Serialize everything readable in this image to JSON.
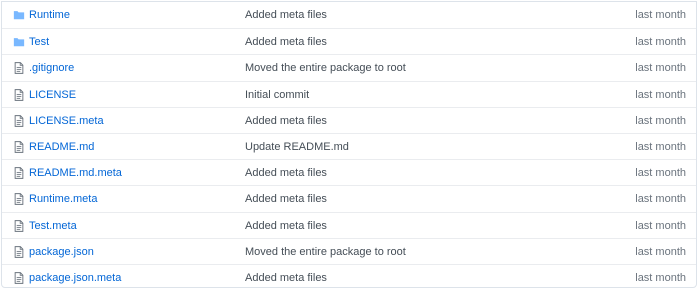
{
  "files": [
    {
      "name": "Runtime",
      "type": "dir",
      "icon": "folder-icon",
      "message": "Added meta files",
      "age": "last month"
    },
    {
      "name": "Test",
      "type": "dir",
      "icon": "folder-icon",
      "message": "Added meta files",
      "age": "last month"
    },
    {
      "name": ".gitignore",
      "type": "file",
      "icon": "file-icon",
      "message": "Moved the entire package to root",
      "age": "last month"
    },
    {
      "name": "LICENSE",
      "type": "file",
      "icon": "file-icon",
      "message": "Initial commit",
      "age": "last month"
    },
    {
      "name": "LICENSE.meta",
      "type": "file",
      "icon": "file-icon",
      "message": "Added meta files",
      "age": "last month"
    },
    {
      "name": "README.md",
      "type": "file",
      "icon": "file-icon",
      "message": "Update README.md",
      "age": "last month"
    },
    {
      "name": "README.md.meta",
      "type": "file",
      "icon": "file-icon",
      "message": "Added meta files",
      "age": "last month"
    },
    {
      "name": "Runtime.meta",
      "type": "file",
      "icon": "file-icon",
      "message": "Added meta files",
      "age": "last month"
    },
    {
      "name": "Test.meta",
      "type": "file",
      "icon": "file-icon",
      "message": "Added meta files",
      "age": "last month"
    },
    {
      "name": "package.json",
      "type": "file",
      "icon": "file-icon",
      "message": "Moved the entire package to root",
      "age": "last month"
    },
    {
      "name": "package.json.meta",
      "type": "file",
      "icon": "file-icon",
      "message": "Added meta files",
      "age": "last month"
    }
  ],
  "colors": {
    "link": "#0366d6",
    "folder_icon": "#79b8ff",
    "file_icon": "#6a737d",
    "border": "#eaecef"
  }
}
